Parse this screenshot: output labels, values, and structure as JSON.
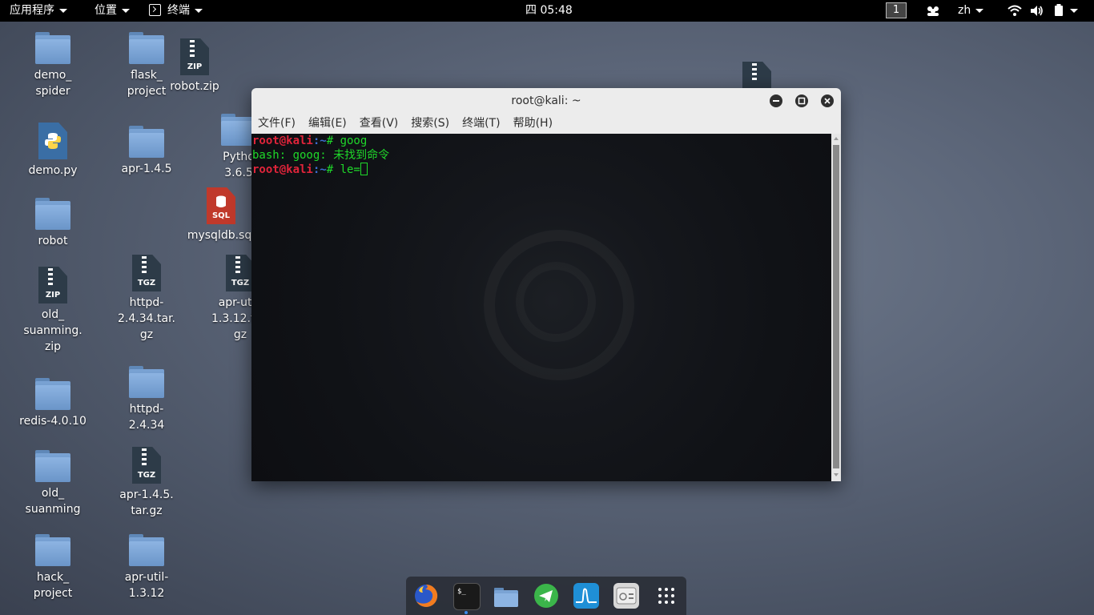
{
  "topbar": {
    "applications": "应用程序",
    "places": "位置",
    "terminal": "终端",
    "clock": "四 05:48",
    "workspace": "1",
    "language": "zh"
  },
  "desktop_icons": [
    {
      "label": "demo_\nspider",
      "type": "folder"
    },
    {
      "label": "flask_\nproject",
      "type": "folder"
    },
    {
      "label": "robot.zip",
      "type": "zip",
      "tag": "ZIP"
    },
    {
      "label": "demo.py",
      "type": "python"
    },
    {
      "label": "apr-1.4.5",
      "type": "folder"
    },
    {
      "label": "Pytho\n3.6.5",
      "type": "folder"
    },
    {
      "label": "mysqldb.sql",
      "type": "sql",
      "tag": "SQL"
    },
    {
      "label": "robot",
      "type": "folder"
    },
    {
      "label": "old_\nsuanming.\nzip",
      "type": "zip",
      "tag": "ZIP"
    },
    {
      "label": "httpd-\n2.4.34.tar.\ngz",
      "type": "tgz",
      "tag": "TGZ"
    },
    {
      "label": "apr-util-\n1.3.12.tar.\ngz",
      "type": "tgz",
      "tag": "TGZ"
    },
    {
      "label": "redis-4.0.10",
      "type": "folder"
    },
    {
      "label": "httpd-\n2.4.34",
      "type": "folder"
    },
    {
      "label": "old_\nsuanming",
      "type": "folder"
    },
    {
      "label": "apr-1.4.5.\ntar.gz",
      "type": "tgz",
      "tag": "TGZ"
    },
    {
      "label": "hack_\nproject",
      "type": "folder"
    },
    {
      "label": "apr-util-\n1.3.12",
      "type": "folder"
    }
  ],
  "window": {
    "title": "root@kali: ~",
    "menu": [
      "文件(F)",
      "编辑(E)",
      "查看(V)",
      "搜索(S)",
      "终端(T)",
      "帮助(H)"
    ]
  },
  "terminal": {
    "lines": [
      {
        "user": "root@kali",
        "path": ":~",
        "prompt": "# ",
        "cmd": "goog"
      },
      {
        "output": "bash: goog: 未找到命令"
      },
      {
        "user": "root@kali",
        "path": ":~",
        "prompt": "# ",
        "cmd": "le="
      }
    ]
  },
  "dock": {
    "apps": [
      "firefox-icon",
      "terminal-icon",
      "files-icon",
      "telegram-icon",
      "wireshark-icon",
      "settings-icon",
      "app-grid-icon"
    ]
  },
  "colors": {
    "prompt_user": "#e0243a",
    "prompt_path": "#3c6ecf",
    "terminal_text": "#1fd82a",
    "dock_active": "#3a8cf0"
  }
}
